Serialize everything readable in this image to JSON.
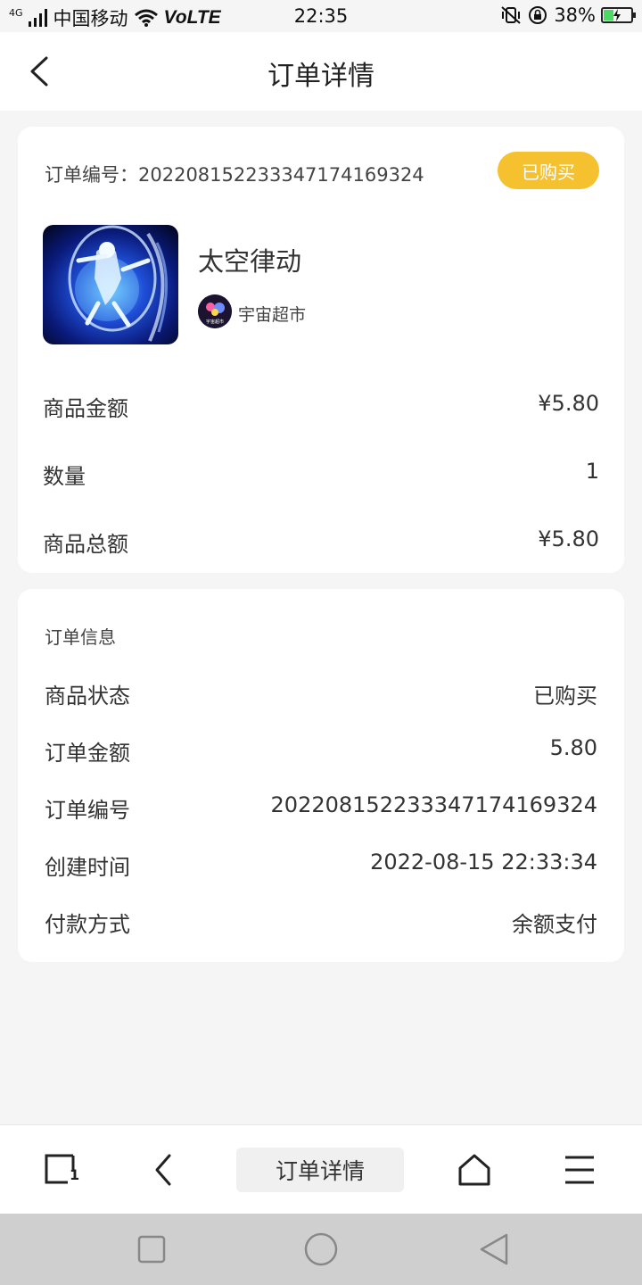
{
  "status_bar": {
    "network": "4G",
    "carrier": "中国移动",
    "volte": "VoLTE",
    "time": "22:35",
    "battery_percent": "38%",
    "battery_level": 0.38,
    "icons": [
      "signal-icon",
      "wifi-icon",
      "vibrate-icon",
      "rotation-lock-icon",
      "battery-icon"
    ]
  },
  "header": {
    "title": "订单详情",
    "back_icon": "chevron-left-icon"
  },
  "order_card": {
    "order_no_label": "订单编号：",
    "order_no": "20220815223334717416932­4",
    "status_badge": "已购买",
    "badge_color": "#f5c12e",
    "product_name": "太空律动",
    "shop_name": "宇宙超市",
    "shop_avatar_text": "宇宙超市",
    "rows": [
      {
        "label": "商品金额",
        "value": "¥5.80"
      },
      {
        "label": "数量",
        "value": "1"
      },
      {
        "label": "商品总额",
        "value": "¥5.80"
      }
    ]
  },
  "info_card": {
    "title": "订单信息",
    "rows": [
      {
        "label": "商品状态",
        "value": "已购买"
      },
      {
        "label": "订单金额",
        "value": "5.80"
      },
      {
        "label": "订单编号",
        "value": "202208152233347174169324"
      },
      {
        "label": "创建时间",
        "value": "2022-08-15 22:33:34"
      },
      {
        "label": "付款方式",
        "value": "余额支付"
      }
    ]
  },
  "toolbar": {
    "tab_count": "1",
    "page_title": "订单详情",
    "icons": [
      "tabs-icon",
      "back-icon",
      "home-icon",
      "menu-icon"
    ]
  },
  "sys_nav": {
    "icons": [
      "recent-apps-icon",
      "home-circle-icon",
      "back-triangle-icon"
    ]
  }
}
